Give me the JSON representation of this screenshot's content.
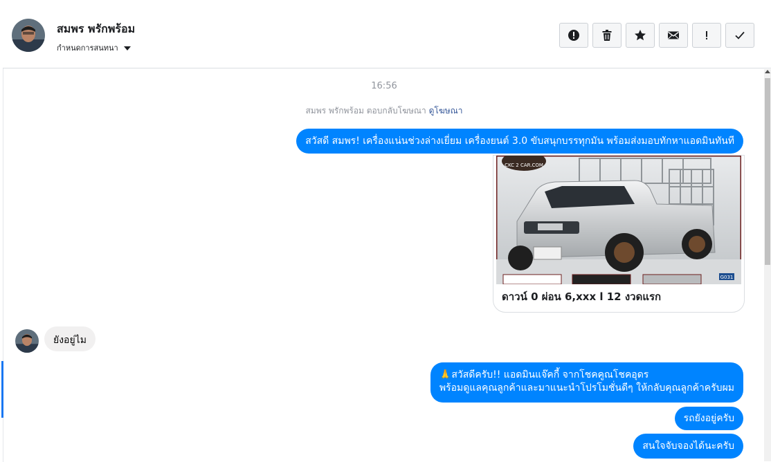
{
  "header": {
    "contact_name": "สมพร พรักพร้อม",
    "assign_label": "กำหนดการสนทนา",
    "toolbar": [
      {
        "icon": "alert-circle-icon",
        "name": "mark-spam-button"
      },
      {
        "icon": "trash-icon",
        "name": "delete-button"
      },
      {
        "icon": "star-icon",
        "name": "star-button"
      },
      {
        "icon": "envelope-icon",
        "name": "mark-unread-button"
      },
      {
        "icon": "exclamation-icon",
        "name": "follow-up-button"
      },
      {
        "icon": "checkmark-icon",
        "name": "mark-done-button"
      }
    ]
  },
  "thread": {
    "timestamp": "16:56",
    "ad_reply_text": "สมพร พรักพร้อม ตอบกลับโฆษณา",
    "ad_reply_link": "ดูโฆษณา",
    "messages": {
      "m1": "สวัสดี สมพร! เครื่องแน่นช่วงล่างเยี่ยม  เครื่องยนต์ 3.0 ขับสนุกบรรทุกมัน พร้อมส่งมอบทักหาแอดมินทันที",
      "card_caption": "ดาวน์ 0 ผ่อน 6,xxx l 12 งวดแรก",
      "card_logo": "CKC 2 CAR.COM",
      "card_code": "G031",
      "m2": "ยังอยู่ไม",
      "m3_emoji": "🙏",
      "m3_line1": "สวัสดีครับ!! แอดมินแจ๊คกี้ จากโชคคูณโชคอุดร",
      "m3_line2": "พร้อมดูแลคุณลูกค้าและมาแนะนำโปรโมชั่นดีๆ ให้กลับคุณลูกค้าครับผม",
      "m4": "รถยังอยู่ครับ",
      "m5": "สนใจจับจองได้นะครับ"
    }
  },
  "colors": {
    "outgoing": "#0084ff",
    "incoming": "#f1f0f0",
    "accent": "#1877f2"
  }
}
